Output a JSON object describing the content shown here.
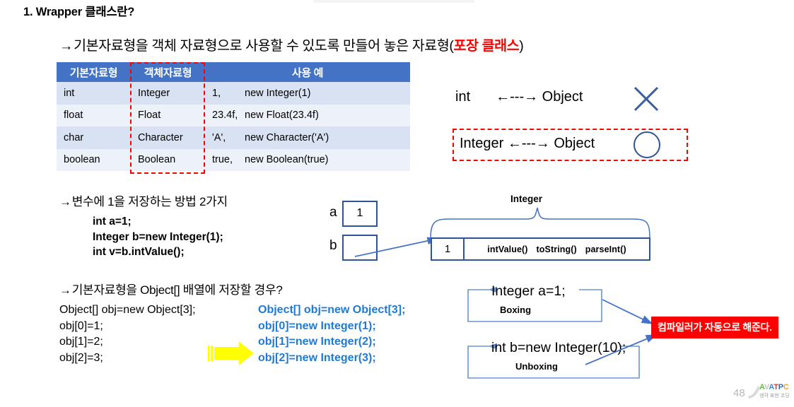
{
  "slide": {
    "title": "1. Wrapper 클래스란?",
    "page_number": "48"
  },
  "lead": {
    "arrow": "→",
    "text_before": "기본자료형을 객체 자료형으로 사용할 수 있도록 만들어 놓은 자료형(",
    "highlight": "포장 클래스",
    "text_after": ")",
    "highlight_color": "#ff0000"
  },
  "table": {
    "header_color": "#4472c4",
    "highlight_border_color": "#ff0000",
    "headers": [
      "기본자료형",
      "객체자료형",
      "사용 예"
    ],
    "rows": [
      {
        "primitive": "int",
        "wrapper": "Integer",
        "literal": "1,",
        "usage": "new Integer(1)"
      },
      {
        "primitive": "float",
        "wrapper": "Float",
        "literal": "23.4f,",
        "usage": "new Float(23.4f)"
      },
      {
        "primitive": "char",
        "wrapper": "Character",
        "literal": "'A',",
        "usage": "new Character('A')"
      },
      {
        "primitive": "boolean",
        "wrapper": "Boolean",
        "literal": "true,",
        "usage": "new Boolean(true)"
      }
    ]
  },
  "relations": {
    "row1": {
      "left": "int",
      "arrow": "←---→",
      "right": "Object",
      "mark": "x-mark"
    },
    "row2": {
      "left": "Integer",
      "arrow": "←---→",
      "right": "Object",
      "mark": "circle-mark"
    }
  },
  "bullet2": {
    "arrow": "→",
    "text": "변수에 1을 저장하는 방법 2가지",
    "code": [
      "int a=1;",
      "Integer b=new Integer(1);",
      "int v=b.intValue();"
    ]
  },
  "memory": {
    "var_a_label": "a",
    "var_a_value": "1",
    "var_b_label": "b",
    "var_b_value": "",
    "object_caption": "Integer",
    "object_value": "1",
    "object_methods": [
      "intValue()",
      "toString()",
      "parseInt()"
    ]
  },
  "bullet3": {
    "arrow": "→",
    "text": "기본자료형을 Object[] 배열에 저장할 경우?",
    "code_left": [
      "Object[] obj=new Object[3];",
      "obj[0]=1;",
      "obj[1]=2;",
      "obj[2]=3;"
    ],
    "code_right": [
      "Object[] obj=new Object[3];",
      "obj[0]=new Integer(1);",
      "obj[1]=new Integer(2);",
      "obj[2]=new Integer(3);"
    ],
    "code_right_color": "#1f7ad6",
    "arrow_color": "#ffff00"
  },
  "boxing": {
    "code": "Integer a=1;",
    "caption": "Boxing"
  },
  "unboxing": {
    "code": "int b=new Integer(10);",
    "caption": "Unboxing"
  },
  "callout": {
    "text": "컴파일러가 자동으로 해준다.",
    "background": "#ff0000",
    "color": "#ffffff"
  },
  "logo": {
    "letters": [
      "A",
      "V",
      "A",
      "T",
      "P",
      "C"
    ],
    "word": "AVATPC",
    "tagline": "생각 표현 코딩"
  }
}
